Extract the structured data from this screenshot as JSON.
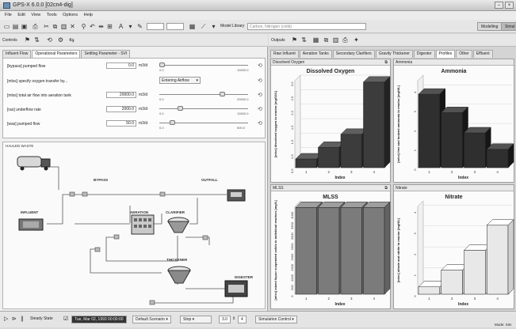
{
  "window": {
    "title": "GPS-X 6.0.0 [02cn4-dig]"
  },
  "menu": [
    "File",
    "Edit",
    "View",
    "Tools",
    "Options",
    "Help"
  ],
  "toolbar": {
    "model_library_label": "Model Library",
    "model_library_value": "Carbon, Nitrogen (cnlib)",
    "tab_modelling": "Modelling",
    "tab_simulation": "Simul"
  },
  "controls": {
    "label": "Controls",
    "tabs": [
      "Influent Flow",
      "Operational Parameters",
      "Settling Parameter - SVI"
    ],
    "selected_tab": 1,
    "params": [
      {
        "label": "[bypass] pumped flow",
        "value": "0.0",
        "unit": "m3/d",
        "min": "0.0",
        "max": "10000.0",
        "level": 0.0
      },
      {
        "label": "[mlss] specify oxygen transfer by...",
        "dropdown": "Entering Airflow"
      },
      {
        "label": "[mlss] total air flow into aeration tank",
        "value": "20000.0",
        "unit": "m3/d",
        "min": "0.0",
        "max": "20000.0",
        "level": 0.72
      },
      {
        "label": "[ras] underflow rate",
        "value": "2000.0",
        "unit": "m3/d",
        "min": "0.0",
        "max": "10000.0",
        "level": 0.22
      },
      {
        "label": "[was] pumped flow",
        "value": "50.0",
        "unit": "m3/d",
        "min": "0.0",
        "max": "500.0",
        "level": 0.12
      }
    ]
  },
  "layout": {
    "section_label": "HAULED WASTE",
    "labels": {
      "bypass": "BYPASS",
      "outfall": "OUTFALL",
      "influent": "INFLUENT",
      "aeration": "AERATION",
      "clarifier": "CLARIFIER",
      "thickener": "THICKENER",
      "digester": "DIGESTER"
    }
  },
  "outputs": {
    "label": "Outputs",
    "tabs": [
      "Raw Influent",
      "Aeration Tanks",
      "Secondary Clarifiers",
      "Gravity Thickener",
      "Digester",
      "Profiles",
      "Other",
      "Effluent"
    ],
    "selected_tab": 5,
    "panels": [
      {
        "header": "Dissolved Oxygen",
        "title": "Dissolved Oxygen"
      },
      {
        "header": "Ammonia",
        "title": "Ammonia"
      },
      {
        "header": "MLSS",
        "title": "MLSS"
      },
      {
        "header": "Nitrate",
        "title": "Nitrate"
      }
    ]
  },
  "chart_data": [
    {
      "type": "bar",
      "title": "Dissolved Oxygen",
      "categories": [
        "1",
        "2",
        "3",
        "4"
      ],
      "values": [
        0.3,
        0.7,
        1.15,
        2.95
      ],
      "xlabel": "Index",
      "ylabel": "[mlss] dissolved oxygen in reactor [mgO2/L]",
      "yticks": [
        "0.0",
        "0.5",
        "1.0",
        "1.5",
        "2.0",
        "2.5",
        "3.0"
      ],
      "ylim": [
        0,
        3.0
      ],
      "color": "#3c3c3c"
    },
    {
      "type": "bar",
      "title": "Ammonia",
      "categories": [
        "1",
        "2",
        "3",
        "4"
      ],
      "values": [
        3.8,
        2.85,
        1.8,
        0.95
      ],
      "xlabel": "Index",
      "ylabel": "[mlss] free and ionized ammonia in reactor [mgN/L]",
      "yticks": [
        "0",
        "1",
        "2",
        "3",
        "4"
      ],
      "ylim": [
        0,
        4.5
      ],
      "color": "#2f2f2f"
    },
    {
      "type": "bar",
      "title": "MLSS",
      "categories": [
        "1",
        "2",
        "3",
        "4"
      ],
      "values": [
        4150,
        4150,
        4150,
        4150
      ],
      "xlabel": "Index",
      "ylabel": "[mlss] mixed liquor suspended solids in individual reactors [mg/L]",
      "yticks": [
        "0",
        "500",
        "1000",
        "1500",
        "2000",
        "2500",
        "3000",
        "3500",
        "4000"
      ],
      "ylim": [
        0,
        4200
      ],
      "color": "#7b7b7b"
    },
    {
      "type": "bar",
      "title": "Nitrate",
      "categories": [
        "1",
        "2",
        "3",
        "4"
      ],
      "values": [
        0.35,
        1.15,
        2.1,
        3.3
      ],
      "xlabel": "Index",
      "ylabel": "[mlss] nitrate and nitrite in reactor [mgN/L]",
      "yticks": [
        "0",
        "1",
        "2",
        "3",
        "4"
      ],
      "ylim": [
        0,
        4.2
      ],
      "color": "#e8e8e8"
    }
  ],
  "status": {
    "mode": "Steady State",
    "datetime": "Tue, Mar 02, 1993 00:00:00",
    "scenario": "Default Scenario",
    "stop": "Stop",
    "speed": "3.0",
    "steps": "4",
    "sim_control": "Simulation Control",
    "footer": "Mode: Sim"
  }
}
